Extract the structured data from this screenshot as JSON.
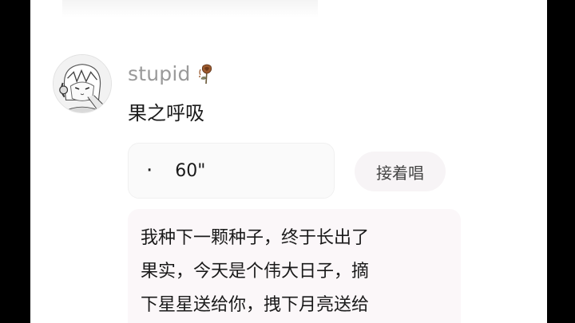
{
  "comment": {
    "username": "stupid",
    "username_icon": "wilted-rose-icon",
    "text": "果之呼吸"
  },
  "voice": {
    "dot": "·",
    "duration": "60\""
  },
  "actions": {
    "sing_along_label": "接着唱"
  },
  "lyrics": {
    "lines": [
      "我种下一颗种子，终于长出了",
      "果实，今天是个伟大日子，摘",
      "下星星送给你，拽下月亮送给"
    ]
  },
  "colors": {
    "username": "#9a9a9a",
    "text": "#1a1a1a",
    "button_bg": "#f7f4f6",
    "card_bg": "#fbf7f9"
  }
}
